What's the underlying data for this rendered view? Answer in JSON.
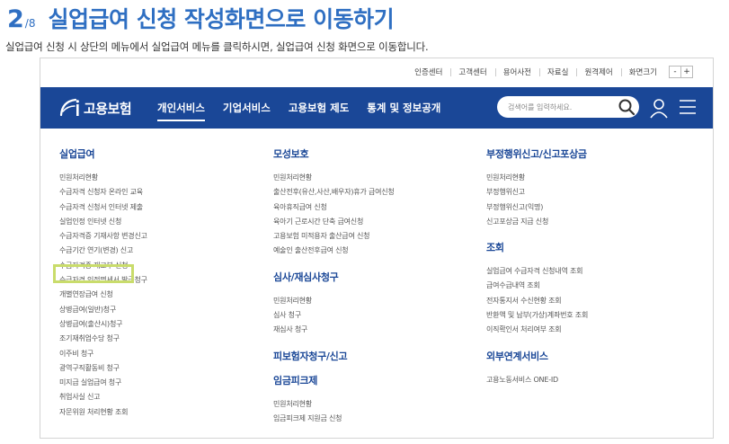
{
  "step": {
    "number": "2",
    "total": "/8",
    "heading": "실업급여 신청 작성화면으로 이동하기"
  },
  "description": "실업급여 신청 시 상단의 메뉴에서 실업급여 메뉴를 클릭하시면, 실업급여 신청 화면으로 이동합니다.",
  "utility": {
    "links": [
      "인증센터",
      "고객센터",
      "용어사전",
      "자료실",
      "원격제어",
      "화면크기"
    ],
    "font_minus": "-",
    "font_plus": "+"
  },
  "header": {
    "logo_text": "고용보험",
    "nav": [
      "개인서비스",
      "기업서비스",
      "고용보험 제도",
      "통계 및 정보공개"
    ],
    "active_nav": "개인서비스",
    "search_placeholder": "검색어를 입력하세요.",
    "brand_color": "#1a4797"
  },
  "highlight_color": "#c9dc6b",
  "highlighted_item": "실업인정 인터넷 신청",
  "columns": [
    {
      "groups": [
        {
          "title": "실업급여",
          "items": [
            "민원처리현황",
            "수급자격 신청자 온라인 교육",
            "수급자격 신청서 인터넷 제출",
            "실업인정 인터넷 신청",
            "수급자격증 기재사항 변경신고",
            "수급기간 연기(변경) 신고",
            "수급자격증 재교부 신청",
            "수급자격 인정명세서 발급청구",
            "개별연장급여 신청",
            "상병급여(일반)청구",
            "상병급여(출산시)청구",
            "조기재취업수당 청구",
            "이주비 청구",
            "광역구직활동비 청구",
            "미지급 실업급여 청구",
            "취업사실 신고",
            "자문위원 처리현황 조회"
          ]
        }
      ]
    },
    {
      "groups": [
        {
          "title": "모성보호",
          "items": [
            "민원처리현황",
            "출산전후(유산,사산,배우자)휴가 급여신청",
            "육아휴직급여 신청",
            "육아기 근로시간 단축 급여신청",
            "고용보험 미적용자 출산급여 신청",
            "예술인 출산전후급여 신청"
          ]
        },
        {
          "title": "심사/재심사청구",
          "items": [
            "민원처리현황",
            "심사 청구",
            "재심사 청구"
          ]
        },
        {
          "title": "피보험자청구/신고",
          "items": []
        },
        {
          "title": "임금피크제",
          "items": [
            "민원처리현황",
            "임금피크제 지원금 신청"
          ]
        }
      ]
    },
    {
      "groups": [
        {
          "title": "부정행위신고/신고포상금",
          "items": [
            "민원처리현황",
            "부정행위신고",
            "부정행위신고(익명)",
            "신고포상금 지급 신청"
          ]
        },
        {
          "title": "조회",
          "items": [
            "실업급여 수급자격 신청내역 조회",
            "급여수급내역 조회",
            "전자통지서 수신현황 조회",
            "반환액 및 납부(가상)계좌번호 조회",
            "이직확인서 처리여부 조회"
          ]
        },
        {
          "title": "외부연계서비스",
          "items": [
            "고용노동서비스 ONE-ID"
          ]
        }
      ]
    }
  ]
}
